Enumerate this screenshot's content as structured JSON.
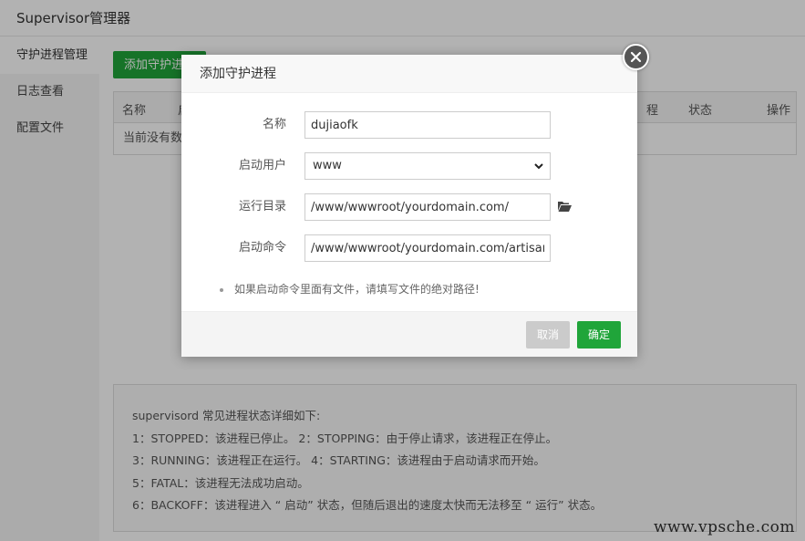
{
  "app": {
    "title": "Supervisor管理器"
  },
  "sidebar": {
    "items": [
      {
        "label": "守护进程管理"
      },
      {
        "label": "日志查看"
      },
      {
        "label": "配置文件"
      }
    ]
  },
  "main": {
    "add_button": "添加守护进程",
    "table": {
      "columns": [
        "名称",
        "启",
        "程",
        "状态",
        "操作"
      ],
      "empty_text": "当前没有数据"
    },
    "info": {
      "lines": [
        "supervisord 常见进程状态详细如下:",
        "1：STOPPED：该进程已停止。      2：STOPPING：由于停止请求，该进程正在停止。",
        "3：RUNNING：该进程正在运行。 4：STARTING：该进程由于启动请求而开始。",
        "5：FATAL：该进程无法成功启动。",
        "6：BACKOFF：该进程进入 “ 启动” 状态，但随后退出的速度太快而无法移至 “ 运行” 状态。"
      ]
    }
  },
  "dialog": {
    "title": "添加守护进程",
    "fields": {
      "name": {
        "label": "名称",
        "value": "dujiaofk"
      },
      "user": {
        "label": "启动用户",
        "value": "www"
      },
      "dir": {
        "label": "运行目录",
        "value": "/www/wwwroot/yourdomain.com/"
      },
      "cmd": {
        "label": "启动命令",
        "value": "/www/wwwroot/yourdomain.com/artisan queue"
      }
    },
    "tip": "如果启动命令里面有文件，请填写文件的绝对路径!",
    "cancel_label": "取消",
    "ok_label": "确定"
  },
  "watermark": "www.vpsche.com",
  "icons": {
    "close": "close-icon",
    "folder": "folder-open-icon",
    "chevron": "chevron-down-icon"
  },
  "colors": {
    "accent": "#20a53a",
    "cancel": "#cbcbcb"
  }
}
